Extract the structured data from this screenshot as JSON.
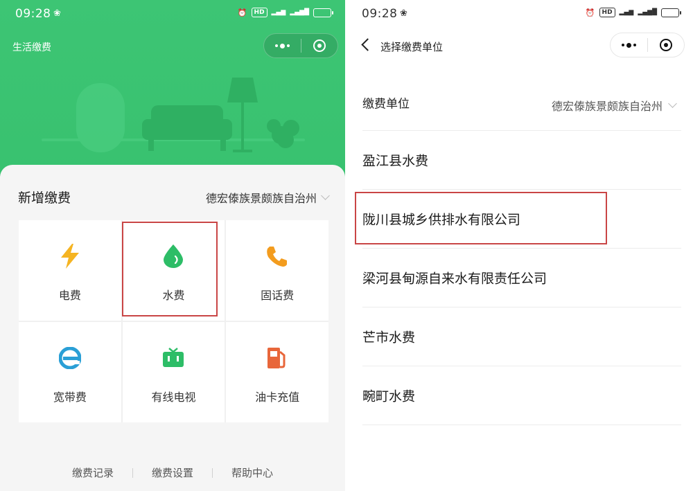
{
  "left": {
    "status": {
      "time": "09:28"
    },
    "app_title": "生活缴费",
    "section_title": "新增缴费",
    "region": "德宏傣族景颇族自治州",
    "tiles": [
      {
        "label": "电费",
        "icon": "lightning-icon"
      },
      {
        "label": "水费",
        "icon": "water-drop-icon"
      },
      {
        "label": "固话费",
        "icon": "phone-icon"
      },
      {
        "label": "宽带费",
        "icon": "broadband-e-icon"
      },
      {
        "label": "有线电视",
        "icon": "tv-icon"
      },
      {
        "label": "油卡充值",
        "icon": "fuel-pump-icon"
      }
    ],
    "bottom_links": [
      "缴费记录",
      "缴费设置",
      "帮助中心"
    ]
  },
  "right": {
    "status": {
      "time": "09:28"
    },
    "nav_title": "选择缴费单位",
    "unit_label": "缴费单位",
    "unit_value": "德宏傣族景颇族自治州",
    "companies": [
      "盈江县水费",
      "陇川县城乡供排水有限公司",
      "梁河县甸源自来水有限责任公司",
      "芒市水费",
      "畹町水费"
    ]
  },
  "colors": {
    "brand_green": "#35bf6c",
    "highlight_red": "#c94545",
    "lightning": "#f5b422",
    "water": "#2dbd67",
    "phone": "#f39c1e",
    "broadband": "#2a9fd6",
    "tv": "#2dbd67",
    "fuel": "#e8663a"
  }
}
